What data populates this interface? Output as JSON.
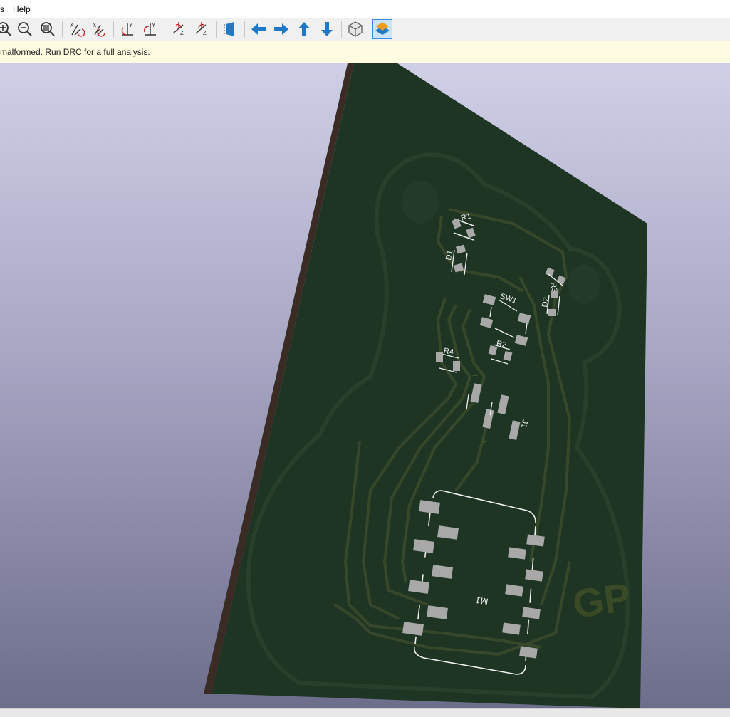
{
  "menu": {
    "partial_item": "s",
    "help": "Help"
  },
  "toolbar": {
    "buttons": [
      "zoom-in",
      "zoom-out",
      "zoom-fit",
      "rotate-x-cw",
      "rotate-x-ccw",
      "rotate-y-cw",
      "rotate-y-ccw",
      "rotate-z-cw",
      "rotate-z-ccw",
      "flip-board",
      "move-left",
      "move-right",
      "move-up",
      "move-down",
      "orthographic-toggle",
      "layers-toggle"
    ],
    "rotate_x_label": "X",
    "rotate_y_label": "Y",
    "rotate_z_label": "Z",
    "active_button": "layers-toggle",
    "accent_color": "#1f78c8"
  },
  "infobar": {
    "message": "malformed. Run DRC for a full analysis."
  },
  "board": {
    "substrate_color": "#1e3524",
    "edge_color": "#3a2c24",
    "trace_color": "#3a4a26",
    "silkscreen_color": "#f0f0f0",
    "pad_color": "#a8a8a8",
    "components": [
      "R1",
      "D1",
      "R3",
      "D2",
      "SW1",
      "R2",
      "R4",
      "J1",
      "M1"
    ],
    "polarity_minus": "−",
    "polarity_plus": "+",
    "logo_text": "GP"
  }
}
